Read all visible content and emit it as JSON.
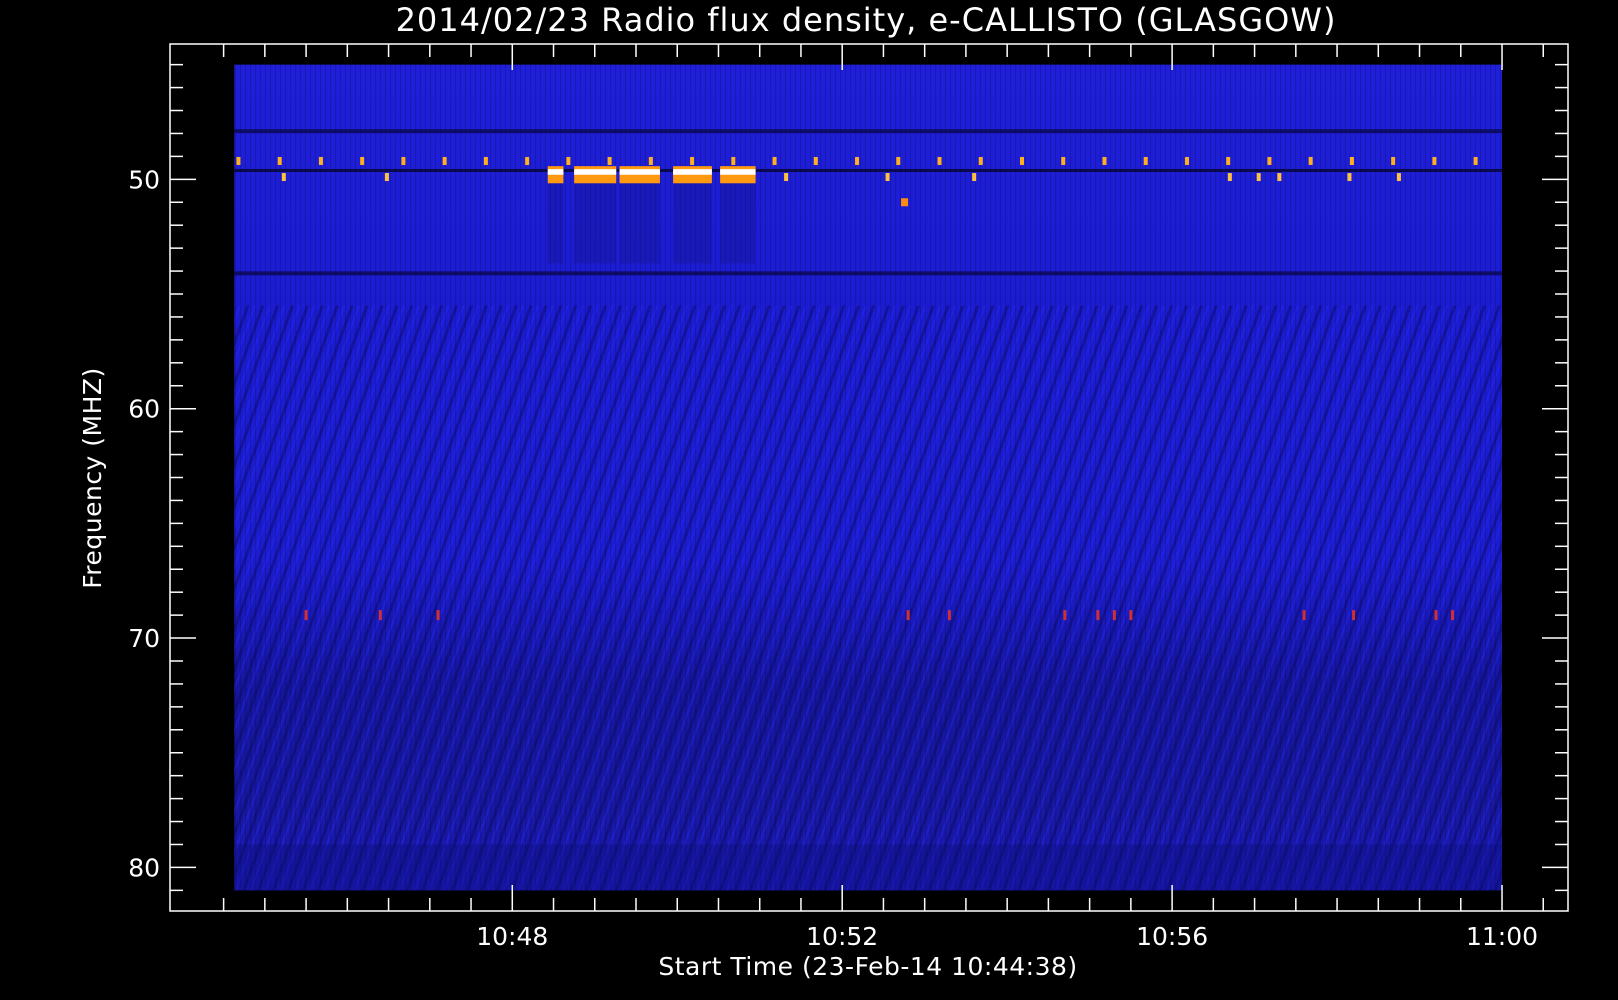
{
  "chart_data": {
    "type": "heatmap",
    "title": "2014/02/23  Radio flux density, e-CALLISTO (GLASGOW)",
    "xlabel": "Start Time (23-Feb-14 10:44:38)",
    "ylabel": "Frequency (MHZ)",
    "x_tick_labels": [
      "10:48",
      "10:52",
      "10:56",
      "11:00"
    ],
    "x_ticks_minutes": [
      48,
      52,
      56,
      60
    ],
    "xlim_minutes": [
      44.63,
      60.0
    ],
    "frame_xlim_minutes": [
      43.85,
      60.8
    ],
    "y_tick_labels": [
      "50",
      "60",
      "70",
      "80"
    ],
    "y_ticks": [
      50,
      60,
      70,
      80
    ],
    "ylim": [
      45,
      81
    ],
    "frame_ylim": [
      44.1,
      81.9
    ],
    "y_inverted": true,
    "grid": false,
    "colormap": [
      "#000018",
      "#0d0d8c",
      "#1a1ad9",
      "#3030ff",
      "#ff2a00",
      "#ff9a10",
      "#ffe070",
      "#ffffff"
    ],
    "features": {
      "pulse_train_mhz": 49.2,
      "pulse_train_low_mhz": 49.9,
      "dark_lines_mhz": [
        47.9,
        54.1
      ],
      "rfi_line_mhz": 69.0,
      "burst_band_mhz": [
        49.6,
        50.0
      ],
      "burst_segments_minutes": [
        [
          48.43,
          48.62
        ],
        [
          48.75,
          49.26
        ],
        [
          49.3,
          49.79
        ],
        [
          49.95,
          50.42
        ],
        [
          50.52,
          50.95
        ]
      ],
      "isolated_spot": [
        52.75,
        51.0
      ]
    }
  }
}
